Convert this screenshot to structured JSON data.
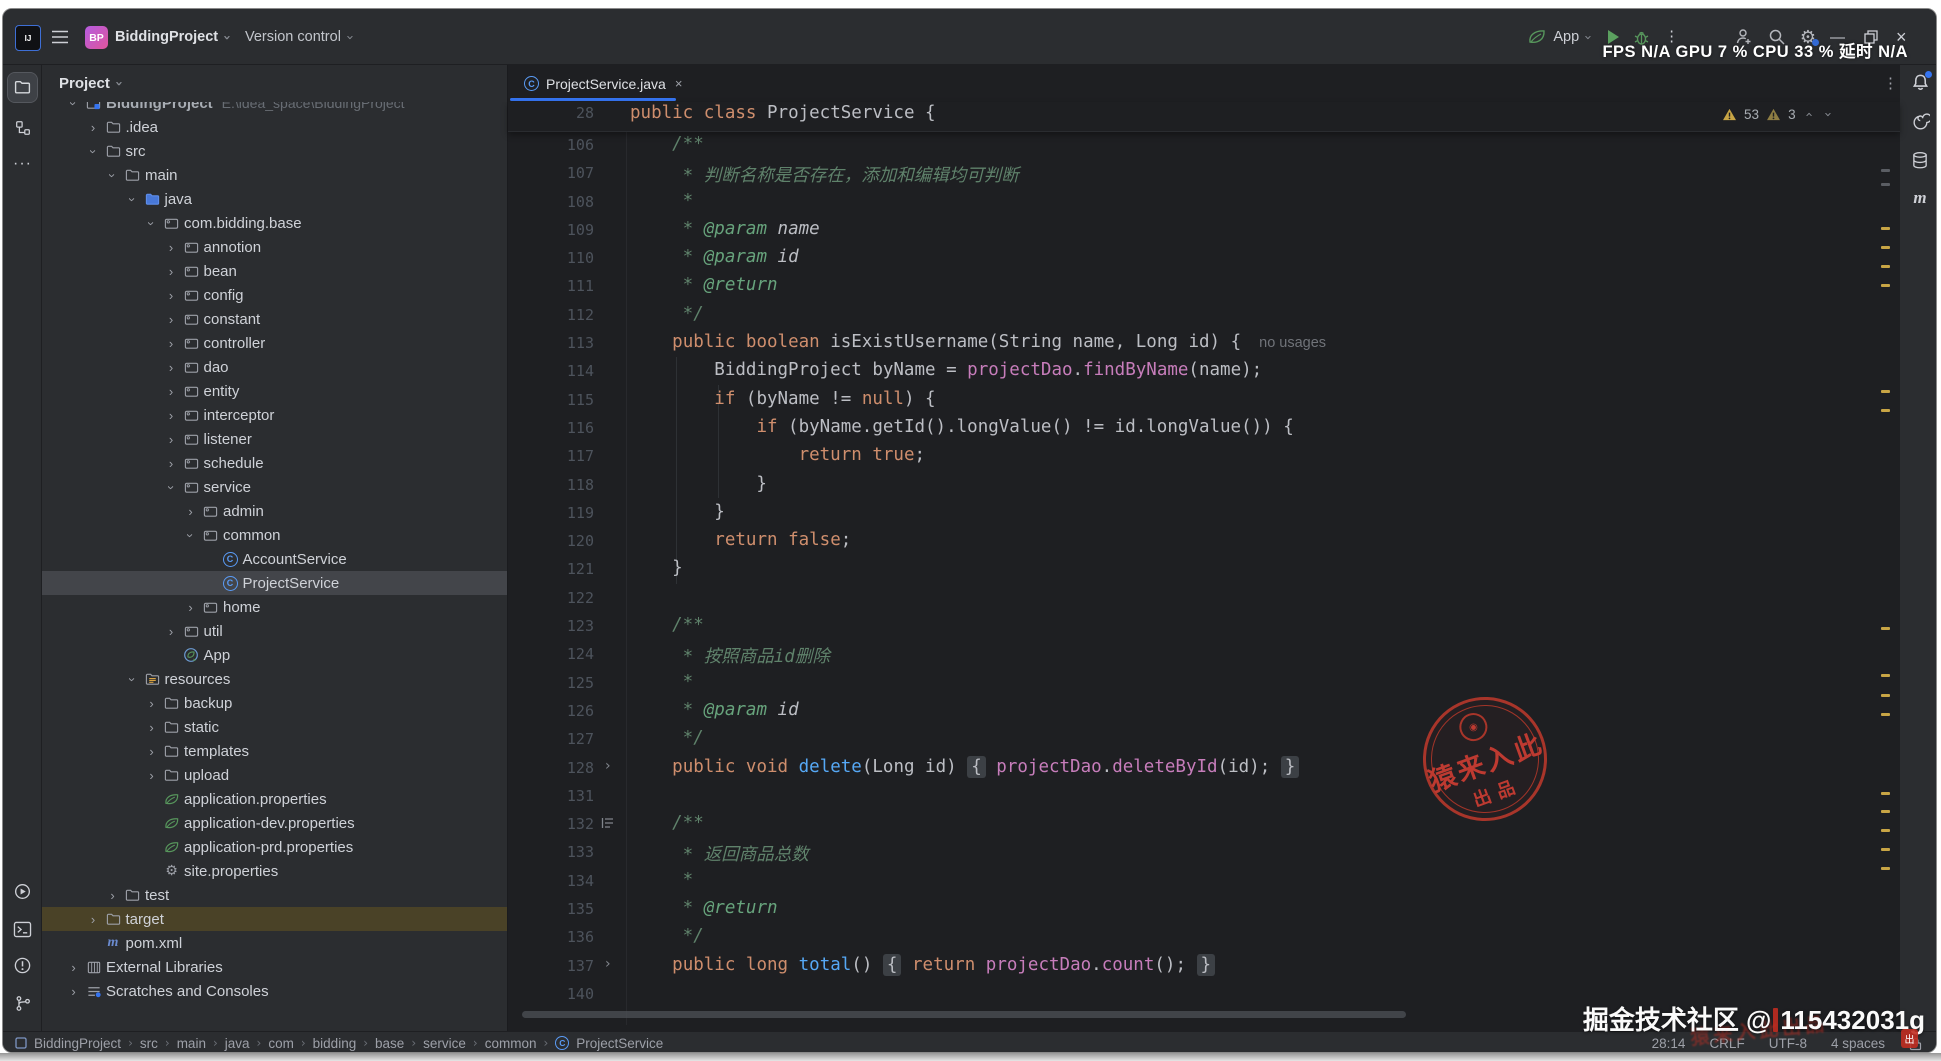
{
  "titlebar": {
    "project_name": "BiddingProject",
    "project_initials": "BP",
    "vcs": "Version control",
    "run_config": "App",
    "perf_overlay": "FPS N/A GPU 7 % CPU 33 % 延时 N/A"
  },
  "icons": {
    "more_vertical": "⋮",
    "more_horizontal": "···",
    "gear": "⚙",
    "chevron": "›",
    "close": "×",
    "minimize": "—",
    "ai": "@"
  },
  "project_panel": {
    "title": "Project",
    "tree": [
      {
        "label": "BiddingProject",
        "extra": "E:\\idea_space\\BiddingProject",
        "d": 0,
        "ch": "v",
        "icon": "project",
        "root": true
      },
      {
        "label": ".idea",
        "d": 1,
        "ch": ">",
        "icon": "folder"
      },
      {
        "label": "src",
        "d": 1,
        "ch": "v",
        "icon": "folder"
      },
      {
        "label": "main",
        "d": 2,
        "ch": "v",
        "icon": "folder"
      },
      {
        "label": "java",
        "d": 3,
        "ch": "v",
        "icon": "folder-java"
      },
      {
        "label": "com.bidding.base",
        "d": 4,
        "ch": "v",
        "icon": "package"
      },
      {
        "label": "annotion",
        "d": 5,
        "ch": ">",
        "icon": "package"
      },
      {
        "label": "bean",
        "d": 5,
        "ch": ">",
        "icon": "package"
      },
      {
        "label": "config",
        "d": 5,
        "ch": ">",
        "icon": "package"
      },
      {
        "label": "constant",
        "d": 5,
        "ch": ">",
        "icon": "package"
      },
      {
        "label": "controller",
        "d": 5,
        "ch": ">",
        "icon": "package"
      },
      {
        "label": "dao",
        "d": 5,
        "ch": ">",
        "icon": "package"
      },
      {
        "label": "entity",
        "d": 5,
        "ch": ">",
        "icon": "package"
      },
      {
        "label": "interceptor",
        "d": 5,
        "ch": ">",
        "icon": "package"
      },
      {
        "label": "listener",
        "d": 5,
        "ch": ">",
        "icon": "package"
      },
      {
        "label": "schedule",
        "d": 5,
        "ch": ">",
        "icon": "package"
      },
      {
        "label": "service",
        "d": 5,
        "ch": "v",
        "icon": "package"
      },
      {
        "label": "admin",
        "d": 6,
        "ch": ">",
        "icon": "package"
      },
      {
        "label": "common",
        "d": 6,
        "ch": "v",
        "icon": "package"
      },
      {
        "label": "AccountService",
        "d": 7,
        "icon": "class"
      },
      {
        "label": "ProjectService",
        "d": 7,
        "icon": "class",
        "sel": true
      },
      {
        "label": "home",
        "d": 6,
        "ch": ">",
        "icon": "package"
      },
      {
        "label": "util",
        "d": 5,
        "ch": ">",
        "icon": "package"
      },
      {
        "label": "App",
        "d": 5,
        "icon": "springboot"
      },
      {
        "label": "resources",
        "d": 3,
        "ch": "v",
        "icon": "folder-res"
      },
      {
        "label": "backup",
        "d": 4,
        "ch": ">",
        "icon": "folder"
      },
      {
        "label": "static",
        "d": 4,
        "ch": ">",
        "icon": "folder"
      },
      {
        "label": "templates",
        "d": 4,
        "ch": ">",
        "icon": "folder"
      },
      {
        "label": "upload",
        "d": 4,
        "ch": ">",
        "icon": "folder"
      },
      {
        "label": "application.properties",
        "d": 4,
        "icon": "spring"
      },
      {
        "label": "application-dev.properties",
        "d": 4,
        "icon": "spring"
      },
      {
        "label": "application-prd.properties",
        "d": 4,
        "icon": "spring"
      },
      {
        "label": "site.properties",
        "d": 4,
        "icon": "gear"
      },
      {
        "label": "test",
        "d": 2,
        "ch": ">",
        "icon": "folder"
      },
      {
        "label": "target",
        "d": 1,
        "ch": ">",
        "icon": "folder",
        "hl": true
      },
      {
        "label": "pom.xml",
        "d": 1,
        "icon": "maven"
      },
      {
        "label": "External Libraries",
        "d": 0,
        "ch": ">",
        "icon": "libs"
      },
      {
        "label": "Scratches and Consoles",
        "d": 0,
        "ch": ">",
        "icon": "scratch"
      }
    ]
  },
  "editor": {
    "tab": {
      "name": "ProjectService.java"
    },
    "inspections": {
      "warnings": "53",
      "weak_warnings": "3"
    },
    "sticky_line": {
      "n": "28",
      "seg": [
        [
          "public",
          "k"
        ],
        [
          " ",
          "p"
        ],
        [
          "class",
          "k"
        ],
        [
          " ",
          "p"
        ],
        [
          "ProjectService",
          "hl"
        ],
        [
          " {",
          "p"
        ]
      ]
    },
    "lines": [
      {
        "n": "106",
        "seg": [
          [
            "    /**",
            "d"
          ]
        ]
      },
      {
        "n": "107",
        "seg": [
          [
            "     * 判断名称是否存在，添加和编辑均可判断",
            "d"
          ]
        ]
      },
      {
        "n": "108",
        "seg": [
          [
            "     *",
            "d"
          ]
        ]
      },
      {
        "n": "109",
        "seg": [
          [
            "     * ",
            "d"
          ],
          [
            "@param",
            "t"
          ],
          [
            " ",
            "d"
          ],
          [
            "name",
            "i w"
          ]
        ]
      },
      {
        "n": "110",
        "seg": [
          [
            "     * ",
            "d"
          ],
          [
            "@param",
            "t"
          ],
          [
            " ",
            "d"
          ],
          [
            "id",
            "i w"
          ]
        ]
      },
      {
        "n": "111",
        "seg": [
          [
            "     * ",
            "d"
          ],
          [
            "@return",
            "t w"
          ]
        ]
      },
      {
        "n": "112",
        "seg": [
          [
            "     */",
            "d"
          ]
        ]
      },
      {
        "n": "113",
        "seg": [
          [
            "    ",
            "p"
          ],
          [
            "public",
            "k"
          ],
          [
            " ",
            "p"
          ],
          [
            "boolean",
            "k"
          ],
          [
            " ",
            "p"
          ],
          [
            "isExistUsername(String name, Long id) {",
            "p"
          ],
          [
            "no usages",
            "h"
          ]
        ]
      },
      {
        "n": "114",
        "seg": [
          [
            "        BiddingProject byName = ",
            "p"
          ],
          [
            "projectDao",
            "f"
          ],
          [
            ".",
            "p"
          ],
          [
            "findByName",
            "f"
          ],
          [
            "(name);",
            "p"
          ]
        ]
      },
      {
        "n": "115",
        "seg": [
          [
            "        ",
            "p"
          ],
          [
            "if",
            "k"
          ],
          [
            " (byName != ",
            "p"
          ],
          [
            "null",
            "k"
          ],
          [
            ") {",
            "p"
          ]
        ]
      },
      {
        "n": "116",
        "seg": [
          [
            "            ",
            "p"
          ],
          [
            "if",
            "k w"
          ],
          [
            " (byName.getId().longValue() != id.longValue()) {",
            "p"
          ]
        ]
      },
      {
        "n": "117",
        "seg": [
          [
            "                ",
            "p"
          ],
          [
            "return",
            "k"
          ],
          [
            " ",
            "p"
          ],
          [
            "true",
            "k"
          ],
          [
            ";",
            "p"
          ]
        ]
      },
      {
        "n": "118",
        "seg": [
          [
            "            }",
            "p"
          ]
        ]
      },
      {
        "n": "119",
        "seg": [
          [
            "        }",
            "p"
          ]
        ]
      },
      {
        "n": "120",
        "seg": [
          [
            "        ",
            "p"
          ],
          [
            "return",
            "k"
          ],
          [
            " ",
            "p"
          ],
          [
            "false",
            "k"
          ],
          [
            ";",
            "p"
          ]
        ]
      },
      {
        "n": "121",
        "seg": [
          [
            "    }",
            "p"
          ]
        ]
      },
      {
        "n": "122",
        "seg": []
      },
      {
        "n": "123",
        "seg": [
          [
            "    /**",
            "d"
          ]
        ]
      },
      {
        "n": "124",
        "seg": [
          [
            "     * 按照商品id删除",
            "d"
          ]
        ]
      },
      {
        "n": "125",
        "seg": [
          [
            "     *",
            "d"
          ]
        ]
      },
      {
        "n": "126",
        "seg": [
          [
            "     * ",
            "d"
          ],
          [
            "@param",
            "t"
          ],
          [
            " ",
            "d"
          ],
          [
            "id",
            "i w"
          ]
        ]
      },
      {
        "n": "127",
        "seg": [
          [
            "     */",
            "d"
          ]
        ]
      },
      {
        "n": "128",
        "fold": true,
        "seg": [
          [
            "    ",
            "p"
          ],
          [
            "public",
            "k"
          ],
          [
            " ",
            "p"
          ],
          [
            "void",
            "k"
          ],
          [
            " ",
            "p"
          ],
          [
            "delete",
            "m"
          ],
          [
            "(Long id) ",
            "p"
          ],
          [
            "{",
            "x"
          ],
          [
            " ",
            "p"
          ],
          [
            "projectDao",
            "f"
          ],
          [
            ".",
            "p"
          ],
          [
            "deleteById",
            "f"
          ],
          [
            "(id); ",
            "p"
          ],
          [
            "}",
            "x"
          ]
        ]
      },
      {
        "n": "131",
        "seg": []
      },
      {
        "n": "132",
        "gicon": true,
        "seg": [
          [
            "    /**",
            "d"
          ]
        ]
      },
      {
        "n": "133",
        "seg": [
          [
            "     * 返回商品总数",
            "d"
          ]
        ]
      },
      {
        "n": "134",
        "seg": [
          [
            "     *",
            "d"
          ]
        ]
      },
      {
        "n": "135",
        "seg": [
          [
            "     * ",
            "d"
          ],
          [
            "@return",
            "t w"
          ]
        ]
      },
      {
        "n": "136",
        "seg": [
          [
            "     */",
            "d"
          ]
        ]
      },
      {
        "n": "137",
        "fold": true,
        "seg": [
          [
            "    ",
            "p"
          ],
          [
            "public",
            "k"
          ],
          [
            " ",
            "p"
          ],
          [
            "long",
            "k"
          ],
          [
            " ",
            "p"
          ],
          [
            "total",
            "m"
          ],
          [
            "() ",
            "p"
          ],
          [
            "{",
            "x"
          ],
          [
            " ",
            "p"
          ],
          [
            "return",
            "k"
          ],
          [
            " ",
            "p"
          ],
          [
            "projectDao",
            "f"
          ],
          [
            ".",
            "p"
          ],
          [
            "count",
            "f"
          ],
          [
            "(); ",
            "p"
          ],
          [
            "}",
            "x"
          ]
        ]
      },
      {
        "n": "140",
        "seg": []
      }
    ],
    "scroll_marks": [
      {
        "t": 104,
        "c": "#5A5D63"
      },
      {
        "t": 118,
        "c": "#5A5D63"
      },
      {
        "t": 162,
        "c": "#C8A545"
      },
      {
        "t": 181,
        "c": "#C8A545"
      },
      {
        "t": 200,
        "c": "#C8A545"
      },
      {
        "t": 219,
        "c": "#C8A545"
      },
      {
        "t": 325,
        "c": "#C8A545"
      },
      {
        "t": 344,
        "c": "#C8A545"
      },
      {
        "t": 562,
        "c": "#C8A545"
      },
      {
        "t": 609,
        "c": "#C8A545"
      },
      {
        "t": 629,
        "c": "#C8A545"
      },
      {
        "t": 648,
        "c": "#C8A545"
      },
      {
        "t": 727,
        "c": "#C8A545"
      },
      {
        "t": 745,
        "c": "#C8A545"
      },
      {
        "t": 764,
        "c": "#C8A545"
      },
      {
        "t": 783,
        "c": "#C8A545"
      },
      {
        "t": 802,
        "c": "#C8A545"
      }
    ]
  },
  "breadcrumbs": [
    "BiddingProject",
    "src",
    "main",
    "java",
    "com",
    "bidding",
    "base",
    "service",
    "common",
    "ProjectService"
  ],
  "status_bar": {
    "caret": "28:14",
    "line_sep": "CRLF",
    "encoding": "UTF-8",
    "indent": "4 spaces"
  },
  "watermark": {
    "stamp_line1": "猿来入此",
    "stamp_line2": "出品",
    "credit_prefix": "掘金技术社区 @",
    "credit_id": "115432031g",
    "seal": "出"
  },
  "colors": {
    "accent": "#3574F0",
    "warning": "#C8A545",
    "keyword": "#CF8E6D",
    "field": "#C77DBB",
    "method": "#56A8F5",
    "doc": "#5F826B"
  }
}
